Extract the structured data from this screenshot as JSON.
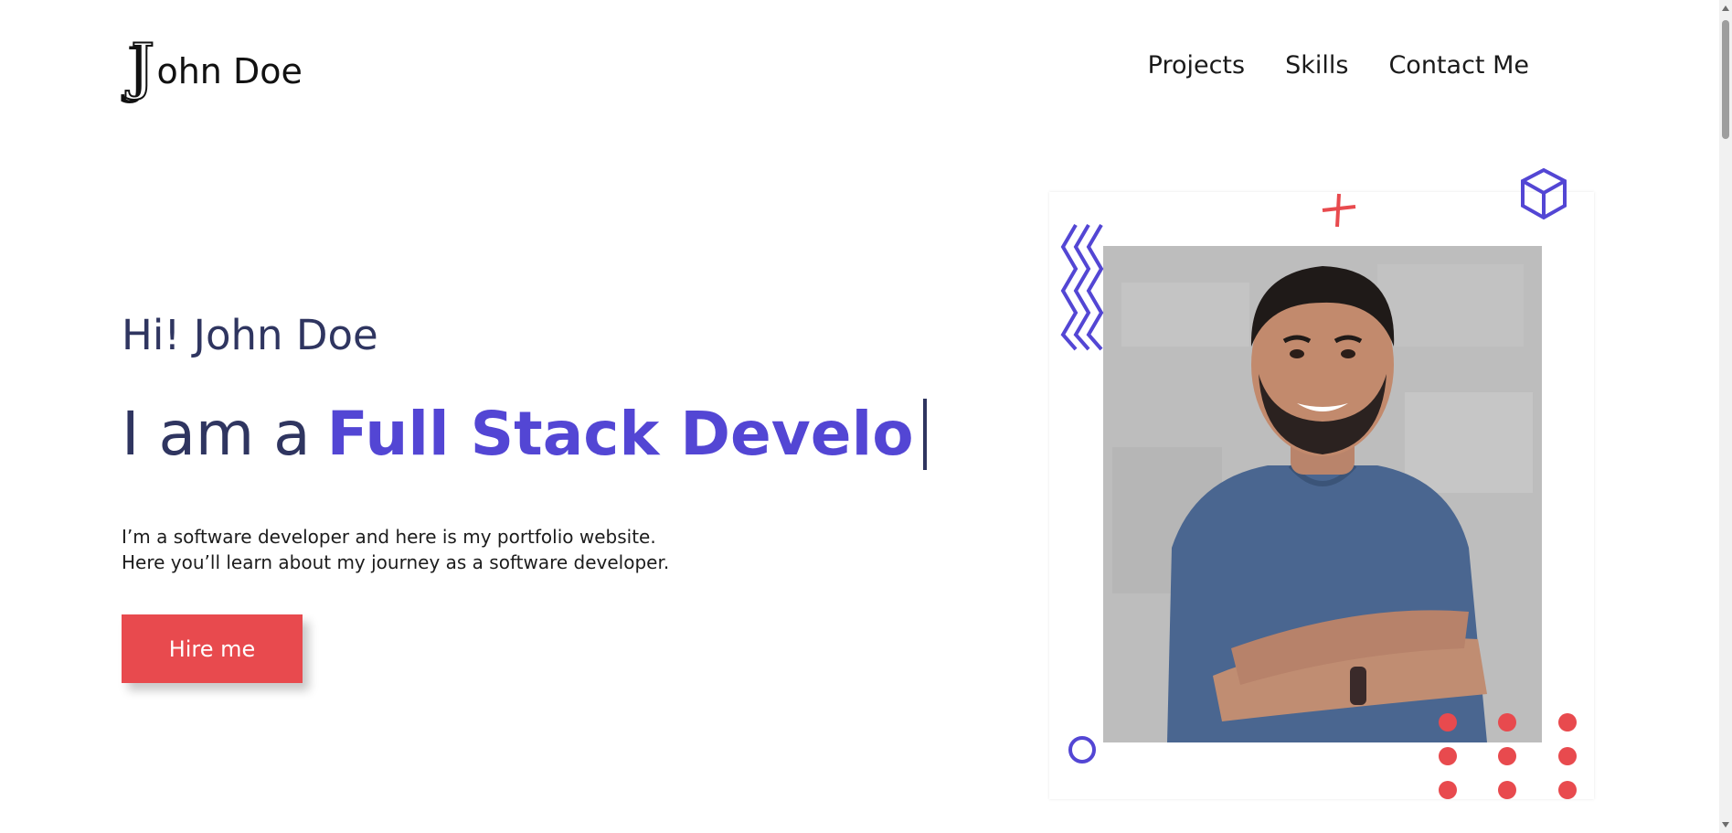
{
  "header": {
    "logo_initial": "J",
    "logo_rest": "ohn Doe",
    "nav": [
      {
        "label": "Projects"
      },
      {
        "label": "Skills"
      },
      {
        "label": "Contact Me"
      }
    ]
  },
  "hero": {
    "greeting": "Hi! John Doe",
    "role_prefix": "I am a",
    "role_typed": "Full Stack Develo",
    "intro_line1": "I’m a software developer and here is my portfolio website.",
    "intro_line2": "Here you’ll learn about my journey as a software developer.",
    "cta_label": "Hire me"
  },
  "colors": {
    "accent": "#5346d4",
    "button": "#e84a4e",
    "heading": "#2f3560",
    "decoration_red": "#e84a4e"
  },
  "icons": [
    "cube-icon",
    "plus-icon",
    "zigzag-decoration",
    "circle-decoration",
    "dots-grid-decoration"
  ]
}
